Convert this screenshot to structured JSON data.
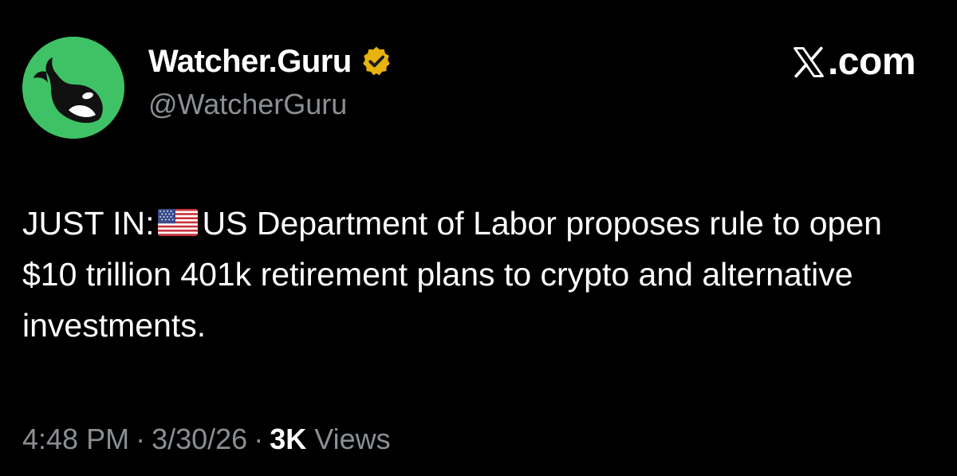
{
  "author": {
    "display_name": "Watcher.Guru",
    "handle": "@WatcherGuru",
    "avatar_color": "#3fc265",
    "verified_badge_color": "#e8b20f"
  },
  "site": {
    "label": ".com",
    "logo_icon": "x-logo-icon"
  },
  "tweet": {
    "prefix": "JUST IN:",
    "flag_icon": "us-flag-icon",
    "text": "US Department of Labor proposes rule to open $10 trillion 401k retirement plans to crypto and alternative investments."
  },
  "meta": {
    "time": "4:48 PM",
    "separator": "·",
    "date": "3/30/26",
    "views_count": "3K",
    "views_label": "Views"
  }
}
